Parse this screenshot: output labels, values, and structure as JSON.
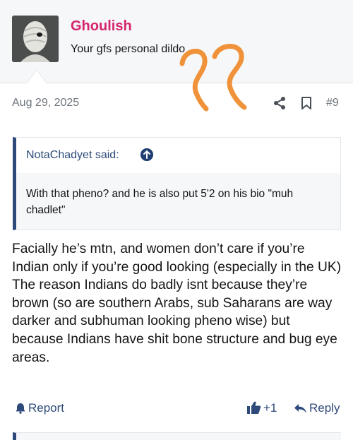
{
  "post": {
    "username": "Ghoulish",
    "user_title": "Your gfs personal dildo",
    "date": "Aug 29, 2025",
    "number": "#9",
    "quote": {
      "author": "NotaChadyet said:",
      "text": "With that pheno? and he is also put 5'2 on his bio \"muh chadlet\""
    },
    "body": "Facially he’s mtn, and women don’t care if you’re Indian only if you’re good looking (especially in the UK) The reason Indians do badly isnt because they’re brown (so are southern Arabs, sub Saharans are way darker and subhuman looking pheno wise) but because Indians have shit bone structure and bug eye areas.",
    "actions": {
      "report": "Report",
      "like_count": "+1",
      "reply": "Reply"
    }
  },
  "annotation": {
    "text": "??",
    "color": "#f0923a"
  },
  "colors": {
    "username": "#d5246d",
    "link": "#2e4a7a",
    "meta": "#6e757c",
    "quote_bar": "#2e4a7a"
  }
}
